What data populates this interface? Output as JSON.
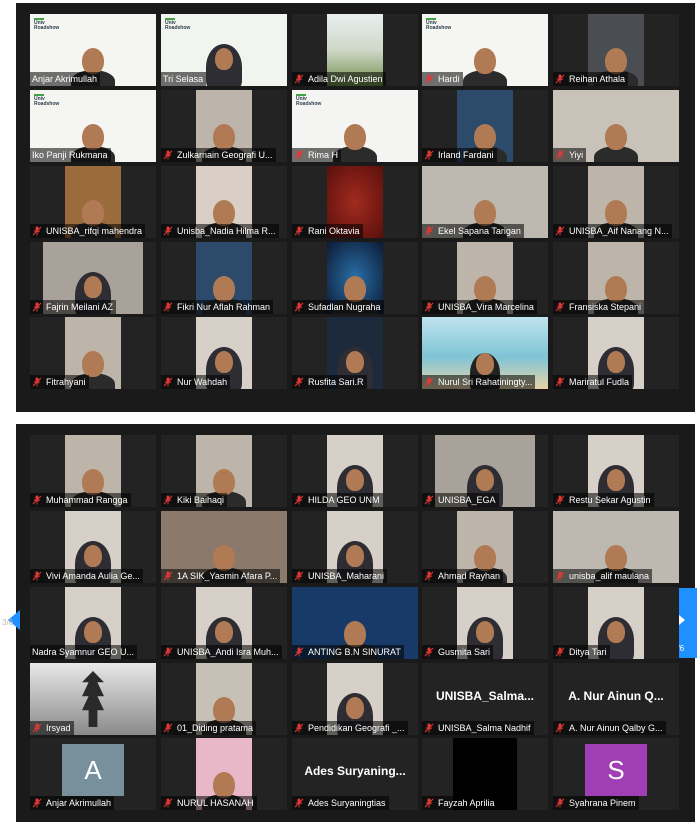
{
  "app": {
    "accent_color": "#c5e02a",
    "nav_color": "#1e90ff"
  },
  "top_grid": [
    {
      "name": "Anjar Akrimullah",
      "muted": false,
      "active": true,
      "kind": "person-logo"
    },
    {
      "name": "Tri Selasa",
      "muted": false,
      "kind": "hijab-logo"
    },
    {
      "name": "Adila Dwi Agustien",
      "muted": true,
      "kind": "outdoor"
    },
    {
      "name": "Hardi",
      "muted": true,
      "kind": "person-logo"
    },
    {
      "name": "Reihan Athala",
      "muted": true,
      "kind": "small-dark"
    },
    {
      "name": "Iko Panji Rukmana",
      "muted": false,
      "kind": "person-logo"
    },
    {
      "name": "Zulkarnain Geografi U...",
      "muted": true,
      "kind": "person"
    },
    {
      "name": "Rima H",
      "muted": true,
      "kind": "glasses-logo"
    },
    {
      "name": "Irland Fardani",
      "muted": true,
      "kind": "person-blue"
    },
    {
      "name": "Yiyi",
      "muted": true,
      "kind": "wide-room"
    },
    {
      "name": "UNISBA_rifqi mahendra",
      "muted": true,
      "kind": "person-warm"
    },
    {
      "name": "Unisba_Nadia Hilma R...",
      "muted": true,
      "kind": "room"
    },
    {
      "name": "Rani Oktavia",
      "muted": true,
      "kind": "red"
    },
    {
      "name": "Ekel Sapana Tarigan",
      "muted": true,
      "kind": "person-wide"
    },
    {
      "name": "UNISBA_Aif Nanang N...",
      "muted": true,
      "kind": "person"
    },
    {
      "name": "Fajrin Meilani AZ",
      "muted": true,
      "kind": "hijab-wide"
    },
    {
      "name": "Fikri Nur Aflah Rahman",
      "muted": true,
      "kind": "person-blue"
    },
    {
      "name": "Sufadlan Nugraha",
      "muted": true,
      "kind": "space"
    },
    {
      "name": "UNISBA_Vira Marcelina",
      "muted": true,
      "kind": "person"
    },
    {
      "name": "Fransiska Stepani",
      "muted": true,
      "kind": "person"
    },
    {
      "name": "Fitrahyani",
      "muted": true,
      "kind": "person"
    },
    {
      "name": "Nur Wahdah",
      "muted": true,
      "kind": "hijab"
    },
    {
      "name": "Rusfita Sari.R",
      "muted": true,
      "kind": "hijab-dark"
    },
    {
      "name": "Nurul Sri Rahatiningty...",
      "muted": true,
      "kind": "beach"
    },
    {
      "name": "Mariratul Fudla",
      "muted": true,
      "kind": "hijab"
    }
  ],
  "bottom_grid": [
    {
      "name": "Muhammad Rangga",
      "muted": true,
      "kind": "person"
    },
    {
      "name": "Kiki Baihaqi",
      "muted": true,
      "kind": "person"
    },
    {
      "name": "HILDA GEO UNM",
      "muted": true,
      "kind": "hijab"
    },
    {
      "name": "UNISBA_EGA",
      "muted": true,
      "kind": "hijab-wide"
    },
    {
      "name": "Restu Sekar Agustin",
      "muted": true,
      "kind": "hijab"
    },
    {
      "name": "Vivi Amanda Aulia Ge...",
      "muted": true,
      "kind": "hijab"
    },
    {
      "name": "1A SIK_Yasmin Afara P...",
      "muted": true,
      "kind": "room-wide"
    },
    {
      "name": "UNISBA_Maharani",
      "muted": true,
      "kind": "hijab"
    },
    {
      "name": "Ahmad Rayhan",
      "muted": true,
      "kind": "person"
    },
    {
      "name": "unisba_alif maulana",
      "muted": true,
      "kind": "person-wide"
    },
    {
      "name": "Nadra Syamnur GEO U...",
      "muted": false,
      "kind": "hijab"
    },
    {
      "name": "UNISBA_Andi Isra Muh...",
      "muted": true,
      "kind": "hijab"
    },
    {
      "name": "ANTING B.N SINURAT",
      "muted": true,
      "kind": "person-blue-wide"
    },
    {
      "name": "Gusmita Sari",
      "muted": true,
      "kind": "hijab"
    },
    {
      "name": "Dityа Tari",
      "muted": true,
      "kind": "hijab"
    },
    {
      "name": "Irsyad",
      "muted": true,
      "kind": "pagoda"
    },
    {
      "name": "01_Diding pratama",
      "muted": true,
      "kind": "person-cap"
    },
    {
      "name": "Pendidikan Geografi _...",
      "muted": true,
      "kind": "hijab"
    },
    {
      "name": "UNISBA_Salma Nadhif",
      "muted": true,
      "kind": "text",
      "big": "UNISBA_Salma..."
    },
    {
      "name": "A. Nur Ainun Qalby G...",
      "muted": true,
      "kind": "text",
      "big": "A. Nur Ainun Q..."
    },
    {
      "name": "Anjar Akrimullah",
      "muted": true,
      "kind": "avatar",
      "letter": "A",
      "color": "#78909c"
    },
    {
      "name": "NURUL HASANAH",
      "muted": true,
      "kind": "pink"
    },
    {
      "name": "Ades Suryaningtias",
      "muted": true,
      "kind": "text",
      "big": "Ades Suryaning..."
    },
    {
      "name": "Fayzah Aprilia",
      "muted": true,
      "kind": "black"
    },
    {
      "name": "Syahrana Pinem",
      "muted": true,
      "kind": "avatar",
      "letter": "S",
      "color": "#a03fb5"
    }
  ],
  "navigation": {
    "left_page": "3/6",
    "right_page": "3/6"
  }
}
